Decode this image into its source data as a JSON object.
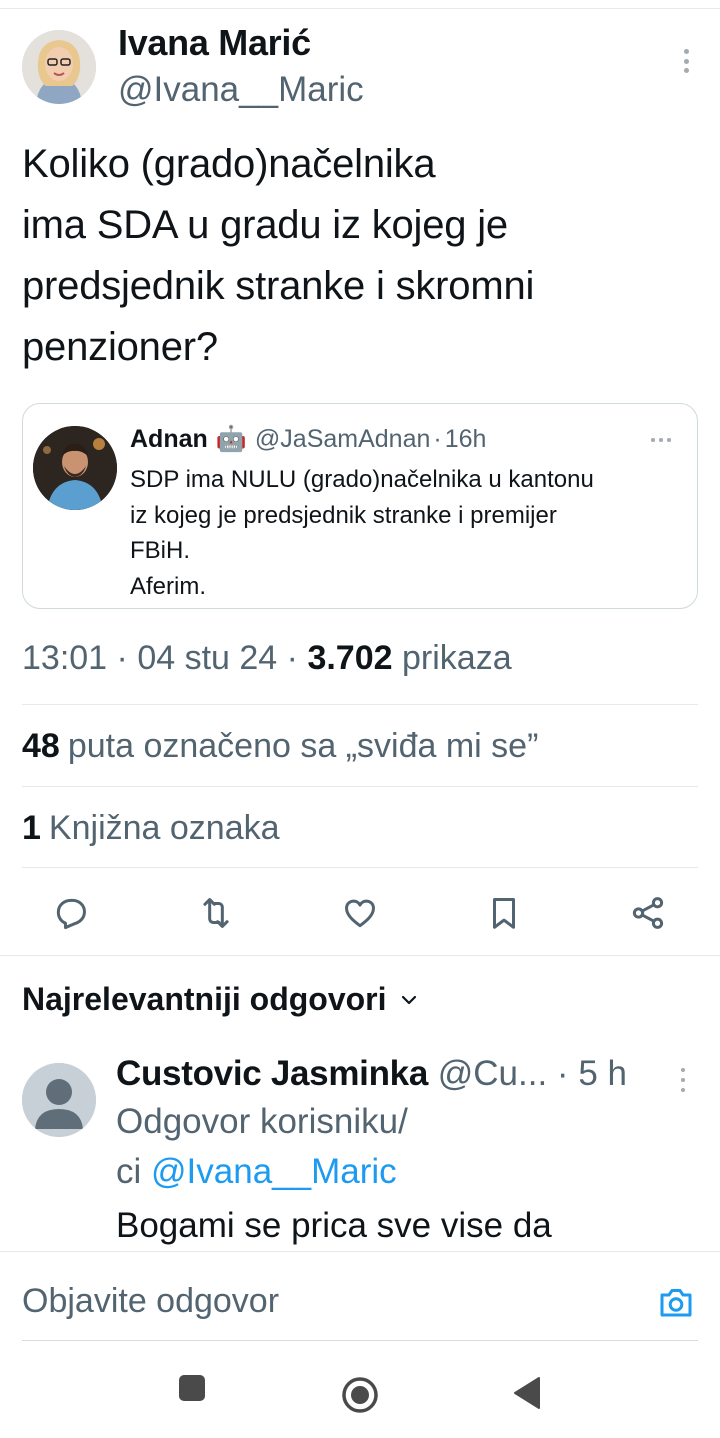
{
  "tweet": {
    "author_name": "Ivana Marić",
    "author_handle": "@Ivana__Maric",
    "text_lines": [
      "Koliko (grado)načelnika",
      "ima SDA u gradu iz kojeg je",
      "predsjednik stranke i skromni",
      "penzioner?"
    ],
    "time": "13:01",
    "date": "04 stu 24",
    "views_count": "3.702",
    "views_label": "prikaza",
    "likes_count": "48",
    "likes_label": "puta označeno sa „sviđa mi se”",
    "bookmarks_count": "1",
    "bookmarks_label": "Knjižna oznaka"
  },
  "quote": {
    "author_name": "Adnan",
    "badge_emoji": "🤖",
    "handle": "@JaSamAdnan",
    "time": "16h",
    "text_lines": [
      "SDP ima NULU (grado)načelnika u kantonu",
      "iz kojeg je predsjednik stranke i premijer",
      "FBiH.",
      "Aferim."
    ]
  },
  "actions": [
    "reply-icon",
    "retweet-icon",
    "like-icon",
    "bookmark-icon",
    "share-icon"
  ],
  "replies_section": {
    "sort_label": "Najrelevantniji odgovori"
  },
  "reply": {
    "author_name": "Custovic Jasminka",
    "handle_truncated": "@Cu...",
    "time": "5 h",
    "replying_to_line1": "Odgovor korisniku/",
    "replying_to_prefix": "ci",
    "replying_to_handle": "@Ivana__Maric",
    "text_preview": "Bogami  se prica sve vise da"
  },
  "composer": {
    "placeholder": "Objavite odgovor"
  },
  "colors": {
    "text_primary": "#0f1419",
    "text_secondary": "#536471",
    "link": "#1d9bf0",
    "divider": "#e6e9ea"
  }
}
